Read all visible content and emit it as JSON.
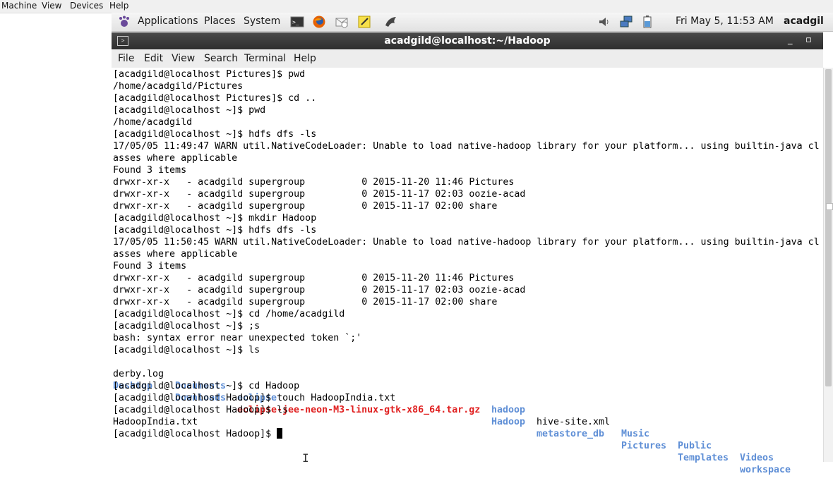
{
  "host_menu": [
    "Machine",
    "View",
    "Devices",
    "Help"
  ],
  "panel": {
    "applications": "Applications",
    "places": "Places",
    "system": "System",
    "datetime": "Fri May  5, 11:53 AM",
    "user": "acadgil"
  },
  "window": {
    "title": "acadgild@localhost:~/Hadoop",
    "minimize": "_",
    "maximize": "▫"
  },
  "term_menu": [
    "File",
    "Edit",
    "View",
    "Search",
    "Terminal",
    "Help"
  ],
  "terminal_lines": [
    "[acadgild@localhost Pictures]$ pwd",
    "/home/acadgild/Pictures",
    "[acadgild@localhost Pictures]$ cd ..",
    "[acadgild@localhost ~]$ pwd",
    "/home/acadgild",
    "[acadgild@localhost ~]$ hdfs dfs -ls",
    "17/05/05 11:49:47 WARN util.NativeCodeLoader: Unable to load native-hadoop library for your platform... using builtin-java cl",
    "asses where applicable",
    "Found 3 items",
    "drwxr-xr-x   - acadgild supergroup          0 2015-11-20 11:46 Pictures",
    "drwxr-xr-x   - acadgild supergroup          0 2015-11-17 02:03 oozie-acad",
    "drwxr-xr-x   - acadgild supergroup          0 2015-11-17 02:00 share",
    "[acadgild@localhost ~]$ mkdir Hadoop",
    "[acadgild@localhost ~]$ hdfs dfs -ls",
    "17/05/05 11:50:45 WARN util.NativeCodeLoader: Unable to load native-hadoop library for your platform... using builtin-java cl",
    "asses where applicable",
    "Found 3 items",
    "drwxr-xr-x   - acadgild supergroup          0 2015-11-20 11:46 Pictures",
    "drwxr-xr-x   - acadgild supergroup          0 2015-11-17 02:03 oozie-acad",
    "drwxr-xr-x   - acadgild supergroup          0 2015-11-17 02:00 share",
    "[acadgild@localhost ~]$ cd /home/acadgild",
    "[acadgild@localhost ~]$ ;s",
    "bash: syntax error near unexpected token `;'",
    "[acadgild@localhost ~]$ ls"
  ],
  "ls_row1": {
    "a": "derby.log",
    "b": "Documents",
    "c": "eclipse",
    "d": "hadoop",
    "e": "hive-site.xml",
    "f": "Music",
    "g": "Public",
    "h": "Videos"
  },
  "ls_row2": {
    "a": "Desktop",
    "b": "Downloads",
    "c": "eclipse-jee-neon-M3-linux-gtk-x86_64.tar.gz",
    "d": "Hadoop",
    "e": "metastore_db",
    "f": "Pictures",
    "g": "Templates",
    "h": "workspace"
  },
  "terminal_lines_tail": [
    "[acadgild@localhost ~]$ cd Hadoop",
    "[acadgild@localhost Hadoop]$ touch HadoopIndia.txt",
    "[acadgild@localhost Hadoop]$ ls",
    "HadoopIndia.txt"
  ],
  "prompt": "[acadgild@localhost Hadoop]$ ",
  "colors": {
    "directory": "#5f8fd6",
    "archive": "#e02020",
    "titlebar": "#3a3a3a"
  },
  "icons": [
    "gnome-foot-icon",
    "terminal-icon",
    "firefox-icon",
    "mail-icon",
    "notes-icon",
    "dolphin-icon",
    "volume-icon",
    "network-icon",
    "battery-icon"
  ]
}
